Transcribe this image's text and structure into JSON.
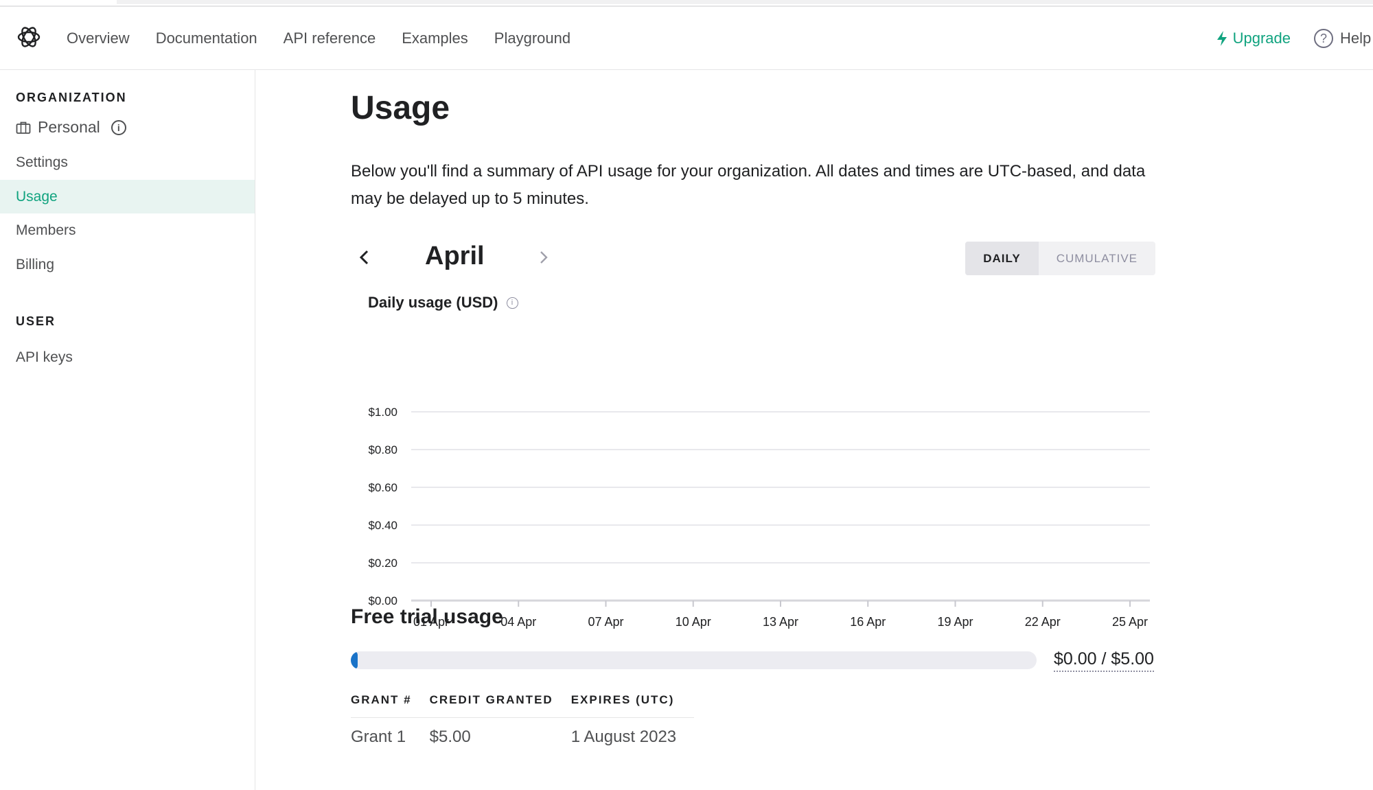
{
  "nav": {
    "links": [
      "Overview",
      "Documentation",
      "API reference",
      "Examples",
      "Playground"
    ],
    "upgrade": "Upgrade",
    "help": "Help",
    "accent": "#10a37f"
  },
  "sidebar": {
    "org_heading": "ORGANIZATION",
    "org_name": "Personal",
    "items": [
      "Settings",
      "Usage",
      "Members",
      "Billing"
    ],
    "active_item": "Usage",
    "user_heading": "USER",
    "user_items": [
      "API keys"
    ]
  },
  "main": {
    "title": "Usage",
    "description": "Below you'll find a summary of API usage for your organization. All dates and times are UTC-based, and data may be delayed up to 5 minutes.",
    "month": "April",
    "view_toggle": [
      "DAILY",
      "CUMULATIVE"
    ],
    "active_view": "DAILY",
    "chart_title": "Daily usage (USD)"
  },
  "chart_data": {
    "type": "bar",
    "title": "Daily usage (USD)",
    "xlabel": "",
    "ylabel": "",
    "categories": [
      "01 Apr",
      "04 Apr",
      "07 Apr",
      "10 Apr",
      "13 Apr",
      "16 Apr",
      "19 Apr",
      "22 Apr",
      "25 Apr"
    ],
    "values": [
      0,
      0,
      0,
      0,
      0,
      0,
      0,
      0,
      0
    ],
    "y_ticks": [
      "$0.00",
      "$0.20",
      "$0.40",
      "$0.60",
      "$0.80",
      "$1.00"
    ],
    "ylim": [
      0,
      1.0
    ],
    "grid": true
  },
  "trial": {
    "title": "Free trial usage",
    "used_fraction": 0.0,
    "amount": "$0.00 / $5.00",
    "bar_color": "#1a73c8"
  },
  "grants": {
    "headers": [
      "GRANT #",
      "CREDIT GRANTED",
      "EXPIRES (UTC)"
    ],
    "rows": [
      [
        "Grant 1",
        "$5.00",
        "1 August 2023"
      ]
    ]
  }
}
